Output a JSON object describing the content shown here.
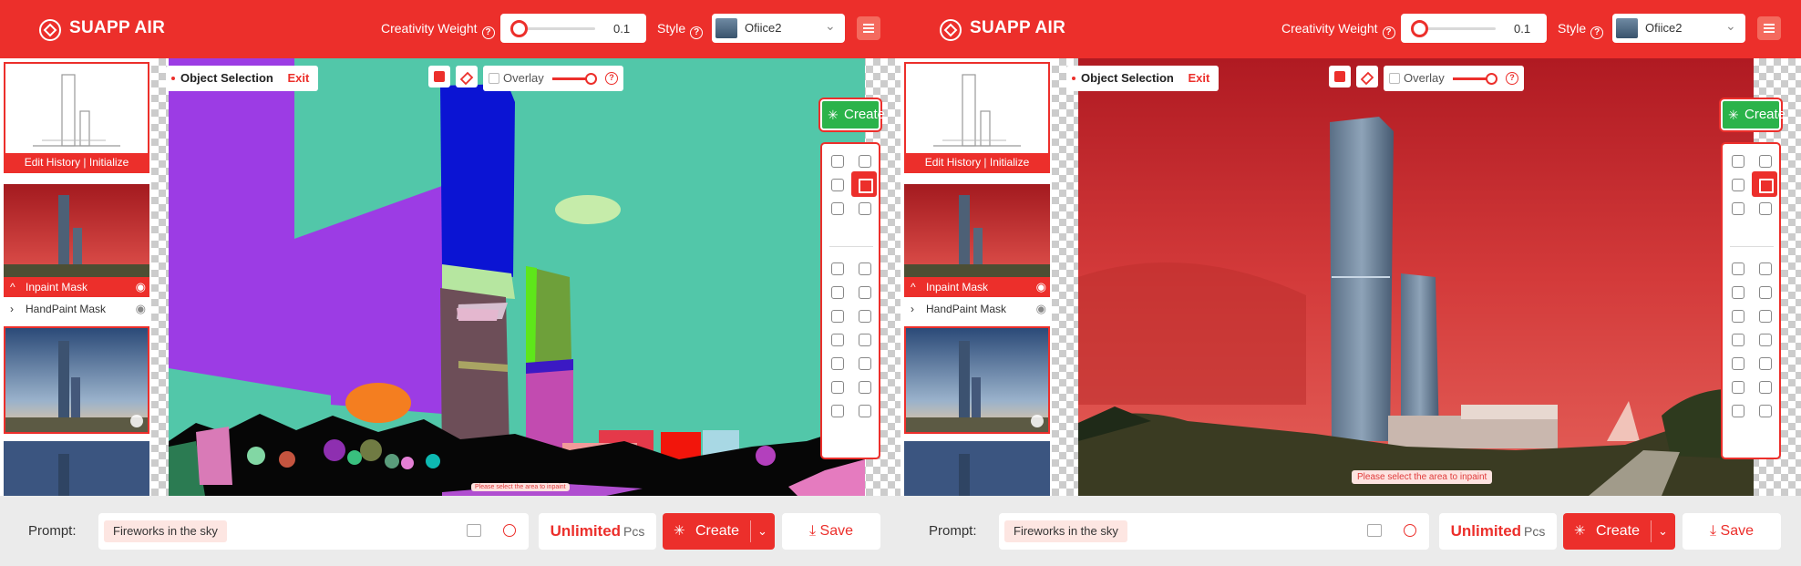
{
  "header": {
    "brand": "SUAPP AIR",
    "creativity_label": "Creativity Weight",
    "creativity_value": "0.1",
    "style_label": "Style",
    "style_value": "Ofiice2"
  },
  "left_panel": {
    "history_label": "Edit History | Initialize",
    "inpaint_mask_label": "Inpaint Mask",
    "handpaint_mask_label": "HandPaint Mask"
  },
  "canvas": {
    "object_selection_label": "Object Selection",
    "exit_label": "Exit",
    "overlay_label": "Overlay",
    "create_side_label": "Create",
    "hint_text": "Please select the area to inpaint",
    "overlay_level": 0.9
  },
  "bottom": {
    "prompt_label": "Prompt:",
    "prompt_value": "Fireworks in the sky",
    "unlimited_label": "Unlimited",
    "pcs_label": "Pcs",
    "create_label": "Create",
    "save_label": "Save"
  },
  "colors": {
    "accent": "#ec2f2b",
    "create_green": "#2bb34a"
  },
  "icons": [
    "logo-icon",
    "help-icon",
    "menu-icon",
    "eye-icon",
    "chevron-icon",
    "refresh-icon",
    "swap-icon",
    "eraser-icon",
    "sparkle-icon",
    "image-icon",
    "crop-icon",
    "download-icon"
  ]
}
